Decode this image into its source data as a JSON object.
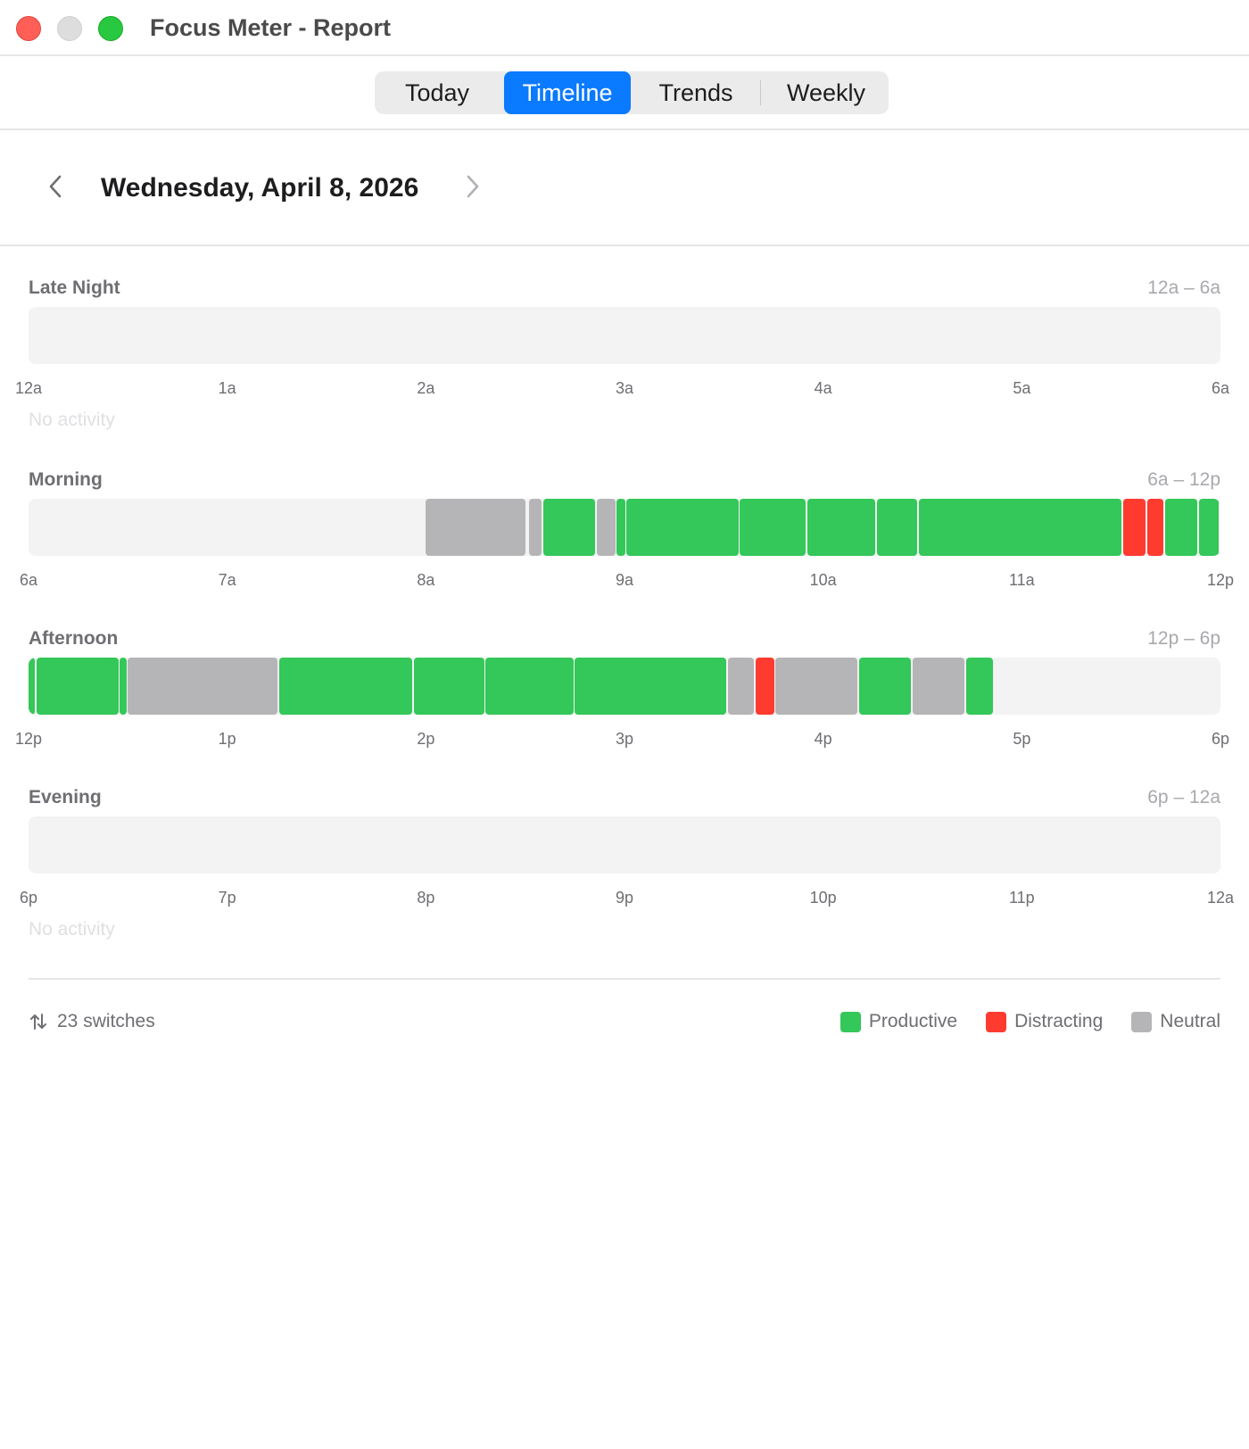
{
  "window": {
    "title": "Focus Meter - Report"
  },
  "tabs": [
    {
      "label": "Today",
      "active": false
    },
    {
      "label": "Timeline",
      "active": true
    },
    {
      "label": "Trends",
      "active": false
    },
    {
      "label": "Weekly",
      "active": false
    }
  ],
  "date": {
    "label": "Wednesday, April 8, 2026"
  },
  "colors": {
    "productive": "#34c759",
    "distracting": "#ff3b30",
    "neutral": "#b5b5b8",
    "accent": "#0a7aff"
  },
  "sections": [
    {
      "title": "Late Night",
      "range": "12a – 6a",
      "ticks": [
        "12a",
        "1a",
        "2a",
        "3a",
        "4a",
        "5a",
        "6a"
      ],
      "empty_text": "No activity",
      "blocks": []
    },
    {
      "title": "Morning",
      "range": "6a – 12p",
      "ticks": [
        "6a",
        "7a",
        "8a",
        "9a",
        "10a",
        "11a",
        "12p"
      ],
      "empty_text": "",
      "blocks": [
        {
          "start_hours": 2.0,
          "end_hours": 2.51,
          "category": "neutral"
        },
        {
          "start_hours": 2.52,
          "end_hours": 2.59,
          "category": "neutral"
        },
        {
          "start_hours": 2.59,
          "end_hours": 2.86,
          "category": "productive"
        },
        {
          "start_hours": 2.86,
          "end_hours": 2.96,
          "category": "neutral"
        },
        {
          "start_hours": 2.96,
          "end_hours": 3.01,
          "category": "productive"
        },
        {
          "start_hours": 3.01,
          "end_hours": 3.58,
          "category": "productive"
        },
        {
          "start_hours": 3.58,
          "end_hours": 3.92,
          "category": "productive"
        },
        {
          "start_hours": 3.92,
          "end_hours": 4.27,
          "category": "productive"
        },
        {
          "start_hours": 4.27,
          "end_hours": 4.48,
          "category": "productive"
        },
        {
          "start_hours": 4.48,
          "end_hours": 5.51,
          "category": "productive"
        },
        {
          "start_hours": 5.51,
          "end_hours": 5.63,
          "category": "distracting"
        },
        {
          "start_hours": 5.63,
          "end_hours": 5.72,
          "category": "distracting"
        },
        {
          "start_hours": 5.72,
          "end_hours": 5.89,
          "category": "productive"
        },
        {
          "start_hours": 5.89,
          "end_hours": 6.0,
          "category": "productive"
        }
      ]
    },
    {
      "title": "Afternoon",
      "range": "12p – 6p",
      "ticks": [
        "12p",
        "1p",
        "2p",
        "3p",
        "4p",
        "5p",
        "6p"
      ],
      "empty_text": "",
      "blocks": [
        {
          "start_hours": 0.0,
          "end_hours": 0.04,
          "category": "productive"
        },
        {
          "start_hours": 0.04,
          "end_hours": 0.46,
          "category": "productive"
        },
        {
          "start_hours": 0.46,
          "end_hours": 0.5,
          "category": "productive"
        },
        {
          "start_hours": 0.5,
          "end_hours": 1.26,
          "category": "neutral"
        },
        {
          "start_hours": 1.26,
          "end_hours": 1.94,
          "category": "productive"
        },
        {
          "start_hours": 1.94,
          "end_hours": 2.3,
          "category": "productive"
        },
        {
          "start_hours": 2.3,
          "end_hours": 2.75,
          "category": "productive"
        },
        {
          "start_hours": 2.75,
          "end_hours": 3.52,
          "category": "productive"
        },
        {
          "start_hours": 3.52,
          "end_hours": 3.66,
          "category": "neutral"
        },
        {
          "start_hours": 3.66,
          "end_hours": 3.76,
          "category": "distracting"
        },
        {
          "start_hours": 3.76,
          "end_hours": 4.18,
          "category": "neutral"
        },
        {
          "start_hours": 4.18,
          "end_hours": 4.45,
          "category": "productive"
        },
        {
          "start_hours": 4.45,
          "end_hours": 4.72,
          "category": "neutral"
        },
        {
          "start_hours": 4.72,
          "end_hours": 4.86,
          "category": "productive"
        }
      ]
    },
    {
      "title": "Evening",
      "range": "6p – 12a",
      "ticks": [
        "6p",
        "7p",
        "8p",
        "9p",
        "10p",
        "11p",
        "12a"
      ],
      "empty_text": "No activity",
      "blocks": []
    }
  ],
  "footer": {
    "switches_icon": "switch-arrows-icon",
    "switches_label": "23 switches",
    "legend": [
      {
        "label": "Productive",
        "category": "productive"
      },
      {
        "label": "Distracting",
        "category": "distracting"
      },
      {
        "label": "Neutral",
        "category": "neutral"
      }
    ]
  }
}
